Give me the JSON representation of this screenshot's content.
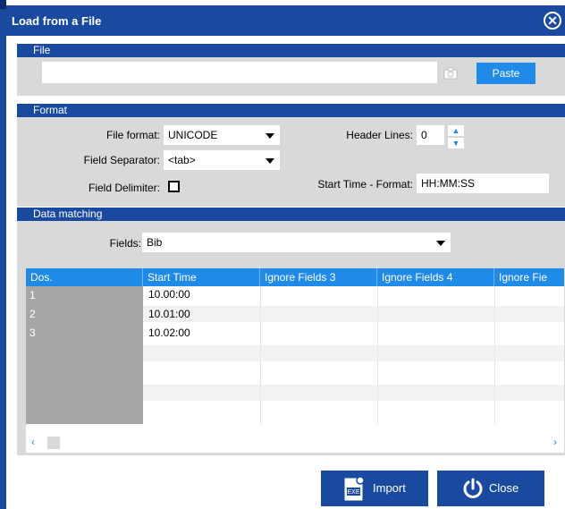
{
  "window": {
    "title": "Load from a File"
  },
  "sections": {
    "file": "File",
    "format": "Format",
    "data_matching": "Data matching"
  },
  "file": {
    "path_value": "",
    "paste_label": "Paste"
  },
  "format": {
    "file_format_label": "File format:",
    "file_format_value": "UNICODE",
    "field_separator_label": "Field Separator:",
    "field_separator_value": "<tab>",
    "field_delimiter_label": "Field Delimiter:",
    "field_delimiter_checked": false,
    "header_lines_label": "Header Lines:",
    "header_lines_value": "0",
    "start_time_format_label": "Start Time - Format:",
    "start_time_format_value": "HH:MM:SS"
  },
  "data_matching": {
    "fields_label": "Fields:",
    "fields_value": "Bib",
    "columns": [
      "Dos.",
      "Start Time",
      "Ignore Fields 3",
      "Ignore Fields 4",
      "Ignore Fie"
    ],
    "rows": [
      {
        "num": "1",
        "start_time": "10.00:00"
      },
      {
        "num": "2",
        "start_time": "10.01:00"
      },
      {
        "num": "3",
        "start_time": "10.02:00"
      }
    ]
  },
  "buttons": {
    "import_label": "Import",
    "close_label": "Close"
  },
  "icons": [
    "close-circle-icon",
    "camera-icon",
    "up-arrow-icon",
    "down-arrow-icon",
    "exe-icon",
    "power-icon",
    "chevron-left-icon",
    "chevron-right-icon"
  ],
  "colors": {
    "title_bar": "#1a4aa0",
    "accent": "#1f8ae8",
    "panel": "#d9d9d9"
  }
}
